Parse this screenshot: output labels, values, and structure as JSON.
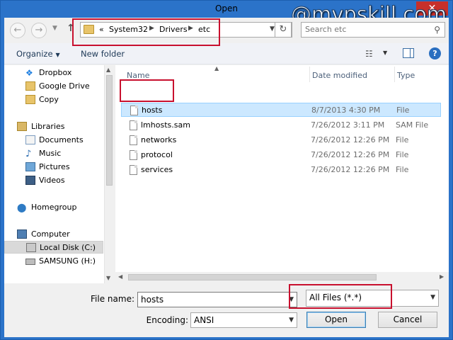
{
  "window": {
    "title": "Open",
    "close_glyph": "✕"
  },
  "watermark": "@mvpskill.com",
  "address": {
    "prefix": "«",
    "crumbs": [
      "System32",
      "Drivers",
      "etc"
    ],
    "search_placeholder": "Search etc"
  },
  "toolbar": {
    "organize": "Organize",
    "new_folder": "New folder"
  },
  "nav": {
    "items": [
      {
        "label": "Dropbox",
        "icon": "dropbox-icon"
      },
      {
        "label": "Google Drive",
        "icon": "google-drive-icon"
      },
      {
        "label": "Copy",
        "icon": "folder-icon"
      },
      {
        "label": "Libraries",
        "icon": "libraries-icon"
      },
      {
        "label": "Documents",
        "icon": "documents-icon"
      },
      {
        "label": "Music",
        "icon": "music-icon"
      },
      {
        "label": "Pictures",
        "icon": "pictures-icon"
      },
      {
        "label": "Videos",
        "icon": "videos-icon"
      },
      {
        "label": "Homegroup",
        "icon": "homegroup-icon"
      },
      {
        "label": "Computer",
        "icon": "computer-icon"
      },
      {
        "label": "Local Disk (C:)",
        "icon": "local-disk-icon"
      },
      {
        "label": "SAMSUNG (H:)",
        "icon": "usb-drive-icon"
      }
    ]
  },
  "columns": {
    "name": "Name",
    "date": "Date modified",
    "type": "Type"
  },
  "files": [
    {
      "name": "hosts",
      "date": "8/7/2013 4:30 PM",
      "type": "File"
    },
    {
      "name": "lmhosts.sam",
      "date": "7/26/2012 3:11 PM",
      "type": "SAM File"
    },
    {
      "name": "networks",
      "date": "7/26/2012 12:26 PM",
      "type": "File"
    },
    {
      "name": "protocol",
      "date": "7/26/2012 12:26 PM",
      "type": "File"
    },
    {
      "name": "services",
      "date": "7/26/2012 12:26 PM",
      "type": "File"
    }
  ],
  "bottom": {
    "file_name_label": "File name:",
    "file_name_value": "hosts",
    "filter_value": "All Files  (*.*)",
    "encoding_label": "Encoding:",
    "encoding_value": "ANSI",
    "open": "Open",
    "cancel": "Cancel"
  },
  "colors": {
    "selection": "#cce8ff",
    "highlight_box": "#c8102e",
    "title_bar": "#2b73c9"
  }
}
